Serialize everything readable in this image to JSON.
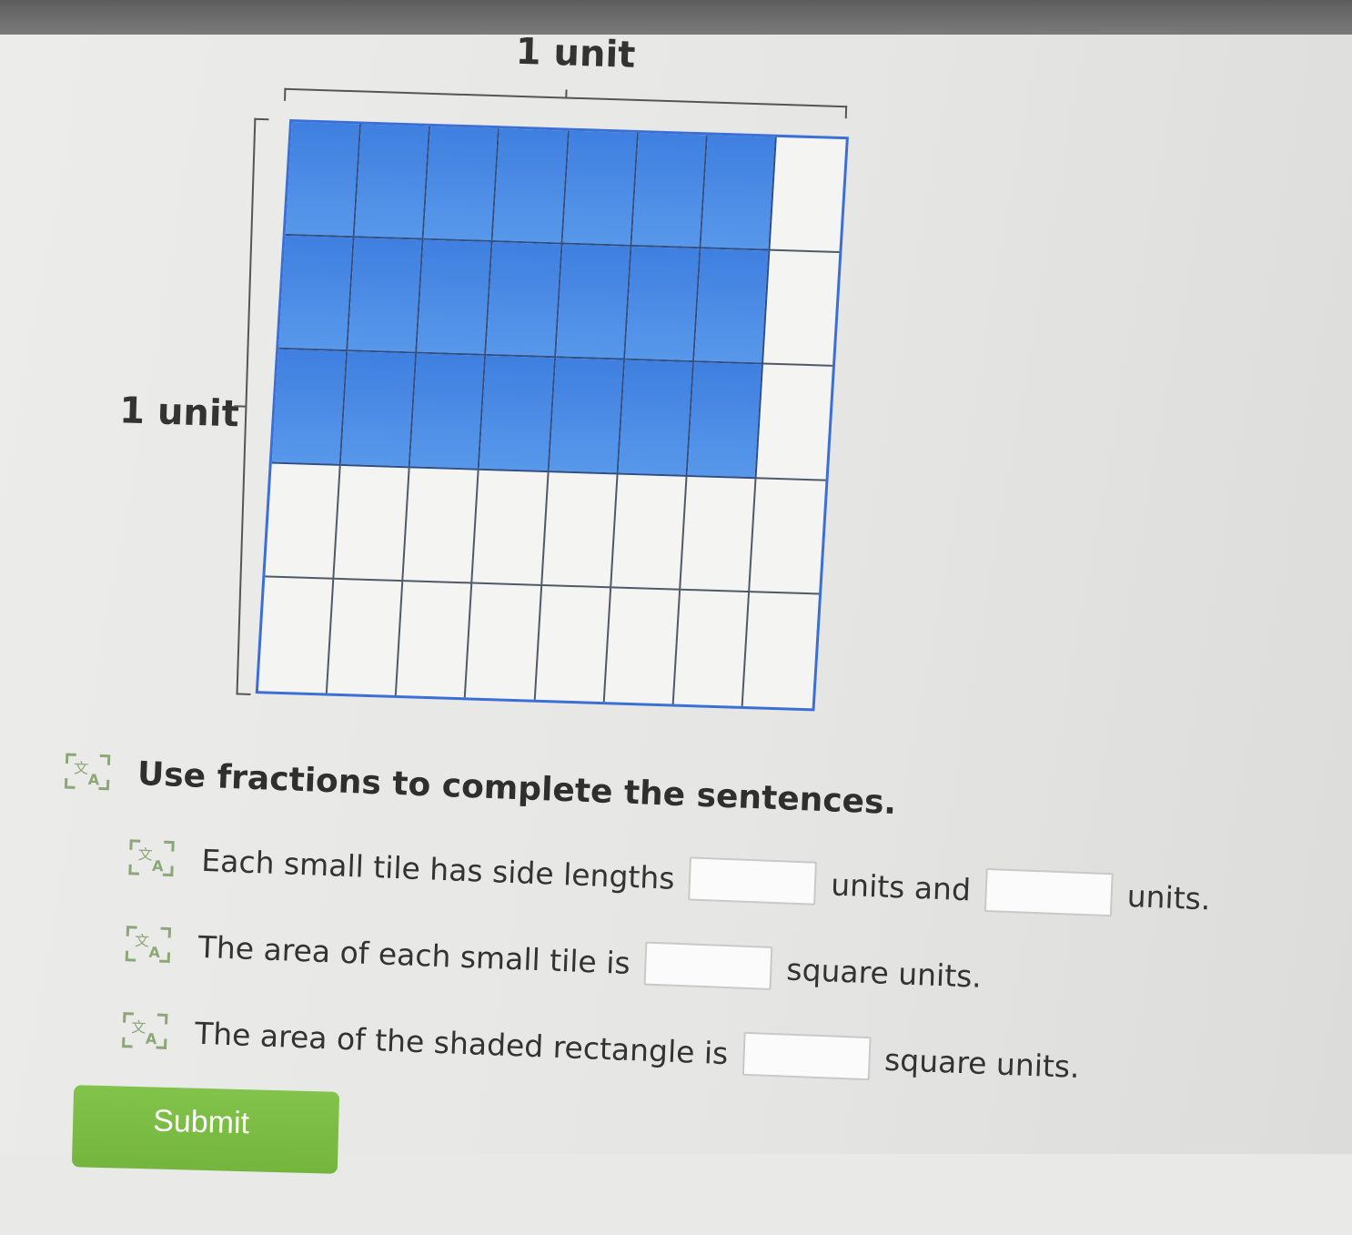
{
  "figure": {
    "top_label": "1 unit",
    "side_label": "1 unit",
    "grid": {
      "columns": 8,
      "rows": 5,
      "shaded_columns": 7,
      "shaded_rows": 3
    },
    "colors": {
      "shaded": "#4a8ce6",
      "border": "#3b6fd6",
      "unshaded": "#f4f4f3"
    }
  },
  "question": {
    "prompt": "Use fractions to complete the sentences.",
    "sentence1": {
      "part1": "Each small tile has side lengths",
      "part2": "units and",
      "part3": "units."
    },
    "sentence2": {
      "part1": "The area of each small tile is",
      "part2": "square units."
    },
    "sentence3": {
      "part1": "The area of the shaded rectangle is",
      "part2": "square units."
    },
    "icon": "audio-translate-icon"
  },
  "submit_label": "Submit",
  "colors": {
    "submit_button": "#7aba42",
    "icon": "#8ca777"
  }
}
